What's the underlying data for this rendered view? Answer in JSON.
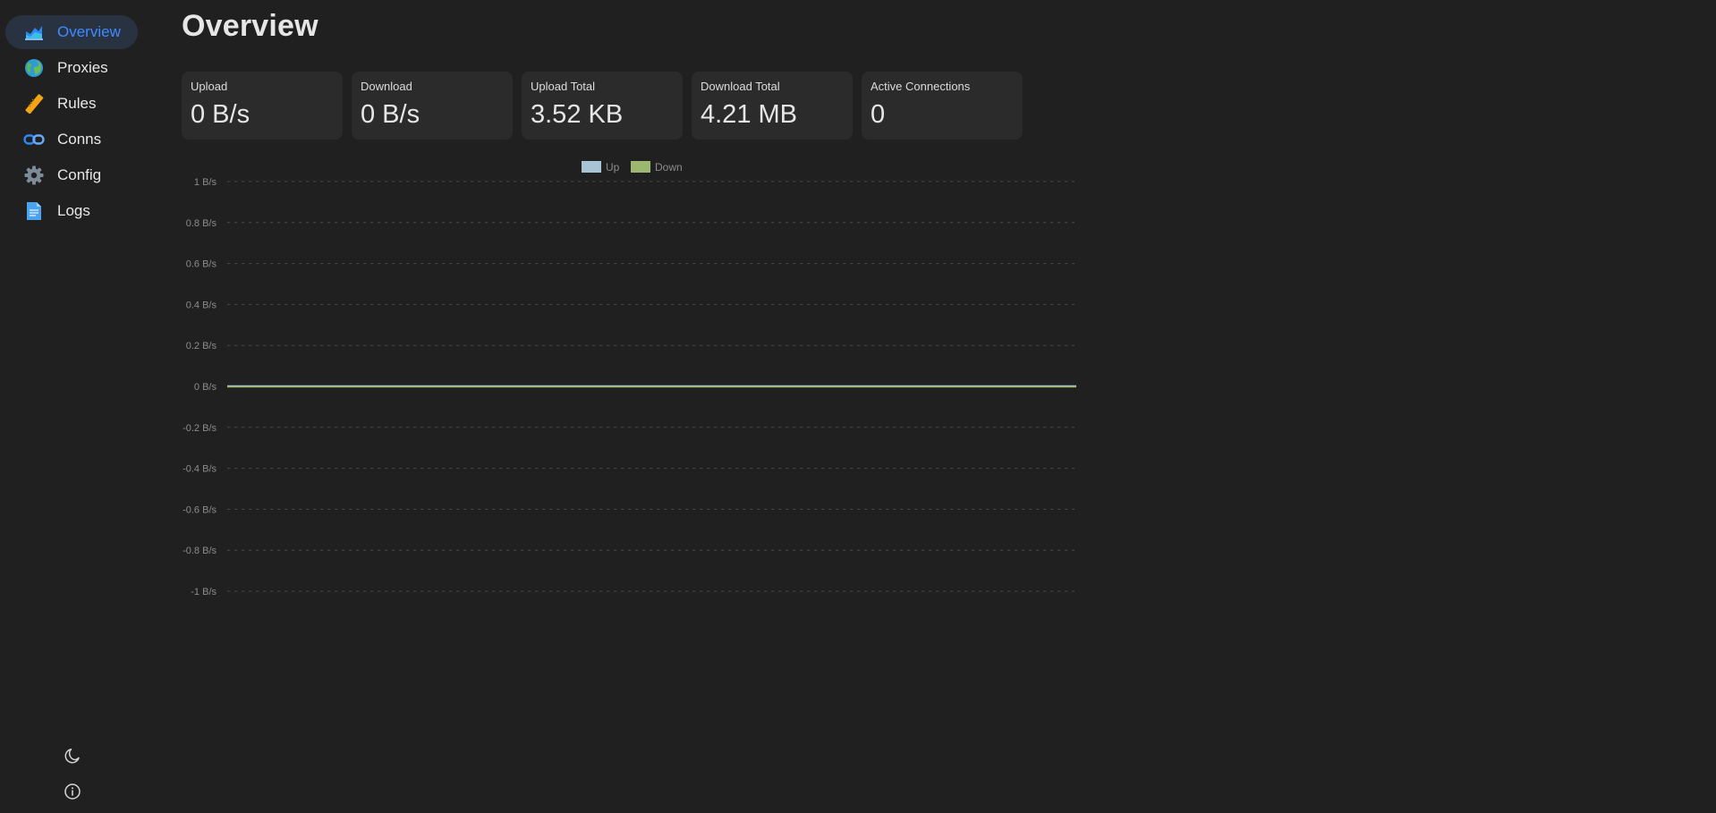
{
  "sidebar": {
    "items": [
      {
        "label": "Overview",
        "icon": "chart-area-icon",
        "active": true
      },
      {
        "label": "Proxies",
        "icon": "globe-icon",
        "active": false
      },
      {
        "label": "Rules",
        "icon": "ruler-icon",
        "active": false
      },
      {
        "label": "Conns",
        "icon": "link-icon",
        "active": false
      },
      {
        "label": "Config",
        "icon": "gear-icon",
        "active": false
      },
      {
        "label": "Logs",
        "icon": "document-icon",
        "active": false
      }
    ],
    "bottom": [
      {
        "icon": "moon-icon"
      },
      {
        "icon": "info-icon"
      }
    ],
    "accent_color": "#3f8bff",
    "active_bg": "#293241"
  },
  "page": {
    "title": "Overview"
  },
  "stats": [
    {
      "label": "Upload",
      "value": "0 B/s"
    },
    {
      "label": "Download",
      "value": "0 B/s"
    },
    {
      "label": "Upload Total",
      "value": "3.52 KB"
    },
    {
      "label": "Download Total",
      "value": "4.21 MB"
    },
    {
      "label": "Active Connections",
      "value": "0"
    }
  ],
  "chart_data": {
    "type": "line",
    "title": "",
    "xlabel": "",
    "ylabel": "",
    "ylim": [
      -1,
      1
    ],
    "y_ticks": [
      "1 B/s",
      "0.8 B/s",
      "0.6 B/s",
      "0.4 B/s",
      "0.2 B/s",
      "0 B/s",
      "-0.2 B/s",
      "-0.4 B/s",
      "-0.6 B/s",
      "-0.8 B/s",
      "-1 B/s"
    ],
    "grid": true,
    "legend_position": "top-center",
    "series": [
      {
        "name": "Up",
        "color": "#a8c4d4",
        "values": [
          0,
          0,
          0,
          0,
          0,
          0,
          0,
          0,
          0,
          0,
          0,
          0,
          0,
          0,
          0,
          0,
          0,
          0,
          0,
          0,
          0,
          0,
          0,
          0,
          0,
          0,
          0,
          0,
          0,
          0
        ]
      },
      {
        "name": "Down",
        "color": "#9cb870",
        "values": [
          0,
          0,
          0,
          0,
          0,
          0,
          0,
          0,
          0,
          0,
          0,
          0,
          0,
          0,
          0,
          0,
          0,
          0,
          0,
          0,
          0,
          0,
          0,
          0,
          0,
          0,
          0,
          0,
          0,
          0
        ]
      }
    ]
  }
}
